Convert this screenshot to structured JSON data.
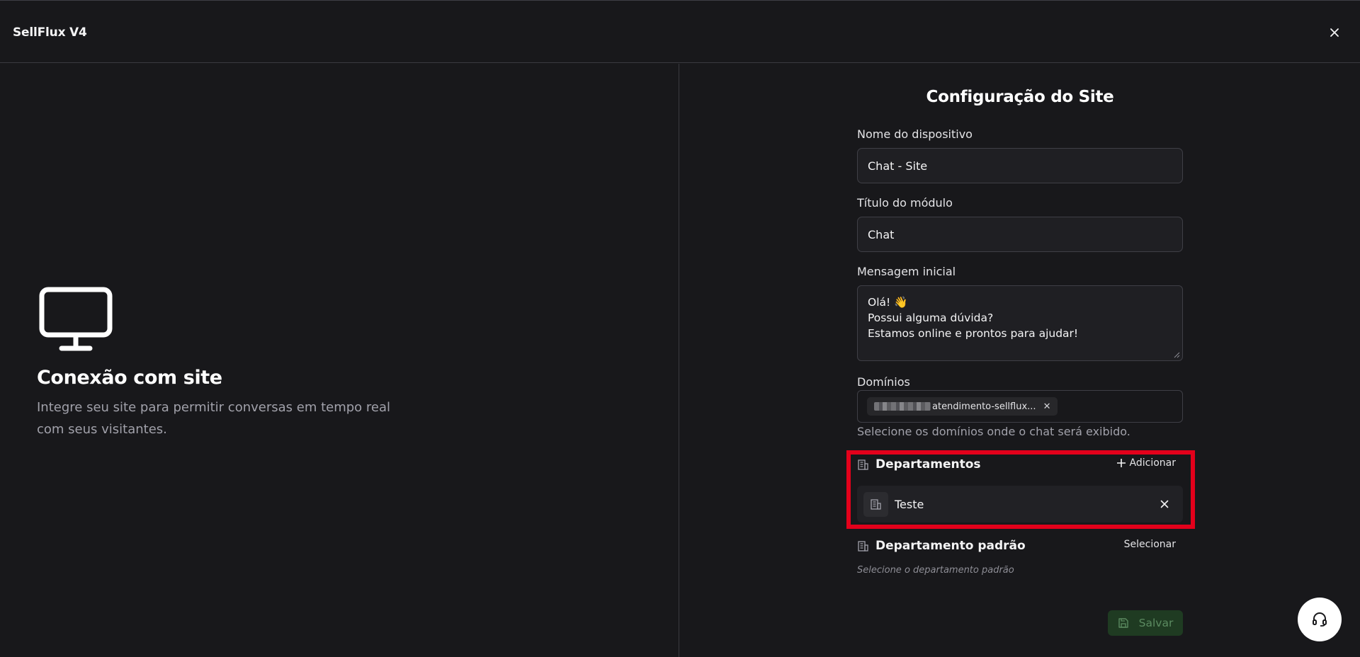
{
  "app": {
    "title": "SellFlux V4"
  },
  "left": {
    "title": "Conexão com site",
    "description": "Integre seu site para permitir conversas em tempo real com seus visitantes."
  },
  "form": {
    "title": "Configuração do Site",
    "device_name": {
      "label": "Nome do dispositivo",
      "value": "Chat - Site"
    },
    "module_title": {
      "label": "Título do módulo",
      "value": "Chat"
    },
    "initial_message": {
      "label": "Mensagem inicial",
      "lines": [
        "Olá! 👋",
        "Possui alguma dúvida?",
        "Estamos online e prontos para ajudar!"
      ]
    },
    "domains": {
      "label": "Domínios",
      "chip_text": "atendimento-sellflux...",
      "hint": "Selecione os domínios onde o chat será exibido."
    },
    "departments": {
      "title": "Departamentos",
      "add_label": "Adicionar",
      "items": [
        {
          "name": "Teste"
        }
      ]
    },
    "default_department": {
      "title": "Departamento padrão",
      "select_label": "Selecionar",
      "hint": "Selecione o departamento padrão"
    },
    "save_label": "Salvar"
  },
  "colors": {
    "background": "#18181b",
    "highlight": "#e3001b",
    "save_bg": "#1f3b22",
    "save_text": "#5b8a60"
  },
  "icons": [
    "close-icon",
    "monitor-icon",
    "building-icon",
    "plus-icon",
    "save-icon",
    "headset-icon"
  ]
}
